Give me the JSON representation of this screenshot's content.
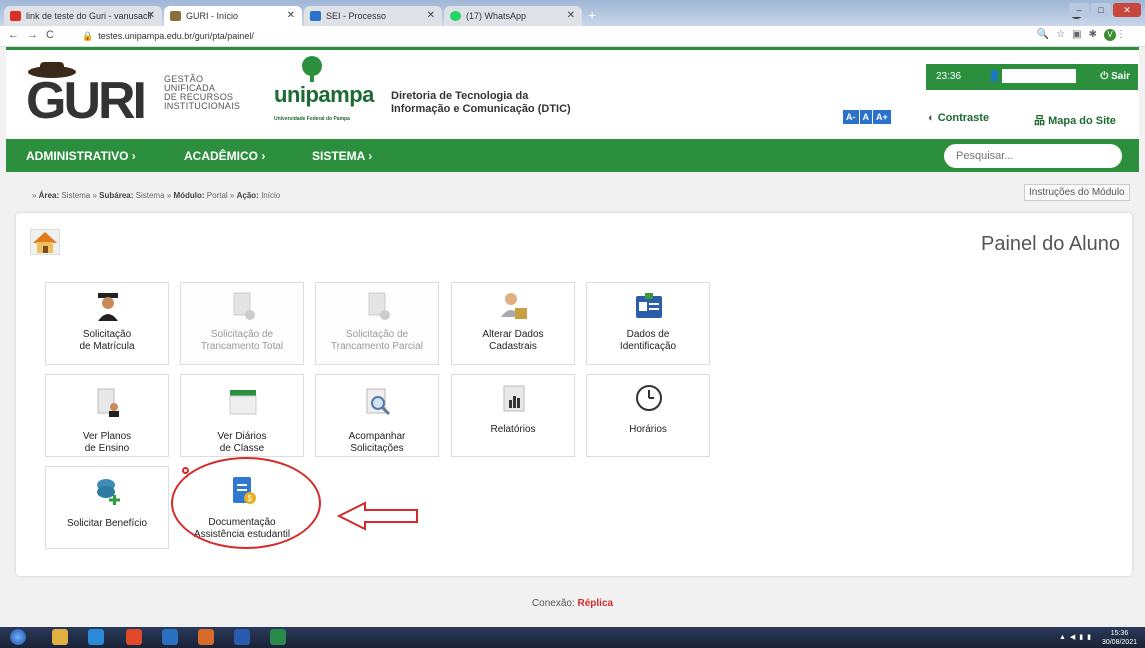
{
  "browser": {
    "tabs": [
      {
        "title": "link de teste do Guri - vanusacli",
        "icon_color": "#d93025"
      },
      {
        "title": "GURI - Início",
        "icon_color": "#8a6d3b"
      },
      {
        "title": "SEI - Processo",
        "icon_color": "#2a72c9"
      },
      {
        "title": "(17) WhatsApp",
        "icon_color": "#25d366"
      }
    ],
    "url": "testes.unipampa.edu.br/guri/pta/painel/",
    "profile_initial": "V"
  },
  "header": {
    "guri_brand": "GURI",
    "guri_subtitle": [
      "GESTÃO",
      "UNIFICADA",
      "DE RECURSOS",
      "INSTITUCIONAIS"
    ],
    "unipampa_brand": "unipampa",
    "unipampa_tagline": "Universidade Federal do Pampa",
    "dtic_line1": "Diretoria de Tecnologia da",
    "dtic_line2": "Informação e Comunicação (DTIC)",
    "time": "23:36",
    "logout": "Sair",
    "font_buttons": [
      "A-",
      "A",
      "A+"
    ],
    "contrast": "Contraste",
    "sitemap": "Mapa do Site"
  },
  "nav": {
    "items": [
      "ADMINISTRATIVO ›",
      "ACADÊMICO ›",
      "SISTEMA ›"
    ],
    "search_placeholder": "Pesquisar..."
  },
  "breadcrumb": {
    "area_label": "Área:",
    "area": "Sistema",
    "subarea_label": "Subárea:",
    "subarea": "Sistema",
    "modulo_label": "Módulo:",
    "modulo": "Portal",
    "acao_label": "Ação:",
    "acao": "Início",
    "instructions": "Instruções do Módulo"
  },
  "panel": {
    "title": "Painel do Aluno",
    "tiles": [
      {
        "l1": "Solicitação",
        "l2": "de Matrícula",
        "icon": "graduate-icon",
        "disabled": false
      },
      {
        "l1": "Solicitação de",
        "l2": "Trancamento Total",
        "icon": "document-lock-icon",
        "disabled": true
      },
      {
        "l1": "Solicitação de",
        "l2": "Trancamento Parcial",
        "icon": "document-lock-icon",
        "disabled": true
      },
      {
        "l1": "Alterar Dados",
        "l2": "Cadastrais",
        "icon": "user-lock-icon",
        "disabled": false
      },
      {
        "l1": "Dados de",
        "l2": "Identificação",
        "icon": "id-card-icon",
        "disabled": false
      },
      {
        "l1": "Ver Planos",
        "l2": "de Ensino",
        "icon": "document-person-icon",
        "disabled": false
      },
      {
        "l1": "Ver Diários",
        "l2": "de Classe",
        "icon": "calendar-icon",
        "disabled": false
      },
      {
        "l1": "Acompanhar",
        "l2": "Solicitações",
        "icon": "magnifier-document-icon",
        "disabled": false
      },
      {
        "l1": "Relatórios",
        "l2": "",
        "icon": "report-chart-icon",
        "disabled": false
      },
      {
        "l1": "Horários",
        "l2": "",
        "icon": "clock-icon",
        "disabled": false
      },
      {
        "l1": "Solicitar Benefício",
        "l2": "",
        "icon": "coins-plus-icon",
        "disabled": false
      },
      {
        "l1": "Documentação",
        "l2": "Assistência estudantil",
        "icon": "dollar-document-icon",
        "disabled": false
      }
    ]
  },
  "footer": {
    "conexao_label": "Conexão:",
    "conexao_value": "Réplica"
  },
  "taskbar": {
    "time": "15:36",
    "date": "30/08/2021"
  }
}
